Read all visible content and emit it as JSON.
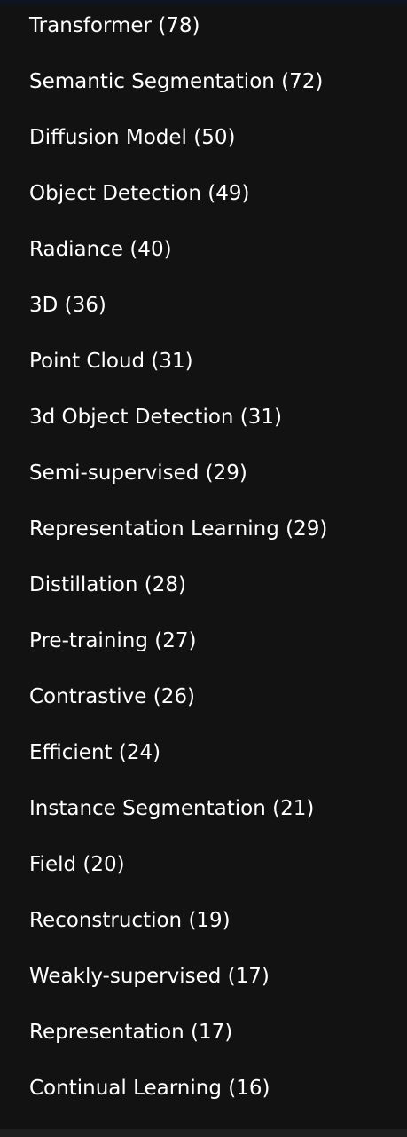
{
  "menu": {
    "items": [
      {
        "label": "Transformer (78)"
      },
      {
        "label": "Semantic Segmentation (72)"
      },
      {
        "label": "Diffusion Model (50)"
      },
      {
        "label": "Object Detection (49)"
      },
      {
        "label": "Radiance (40)"
      },
      {
        "label": "3D (36)"
      },
      {
        "label": "Point Cloud (31)"
      },
      {
        "label": "3d Object Detection (31)"
      },
      {
        "label": "Semi-supervised (29)"
      },
      {
        "label": "Representation Learning (29)"
      },
      {
        "label": "Distillation (28)"
      },
      {
        "label": "Pre-training (27)"
      },
      {
        "label": "Contrastive (26)"
      },
      {
        "label": "Efficient (24)"
      },
      {
        "label": "Instance Segmentation (21)"
      },
      {
        "label": "Field (20)"
      },
      {
        "label": "Reconstruction (19)"
      },
      {
        "label": "Weakly-supervised (17)"
      },
      {
        "label": "Representation (17)"
      },
      {
        "label": "Continual Learning (16)"
      }
    ]
  },
  "colors": {
    "background": "#121212",
    "text": "#ffffff",
    "top_strip": "#0d1424"
  }
}
